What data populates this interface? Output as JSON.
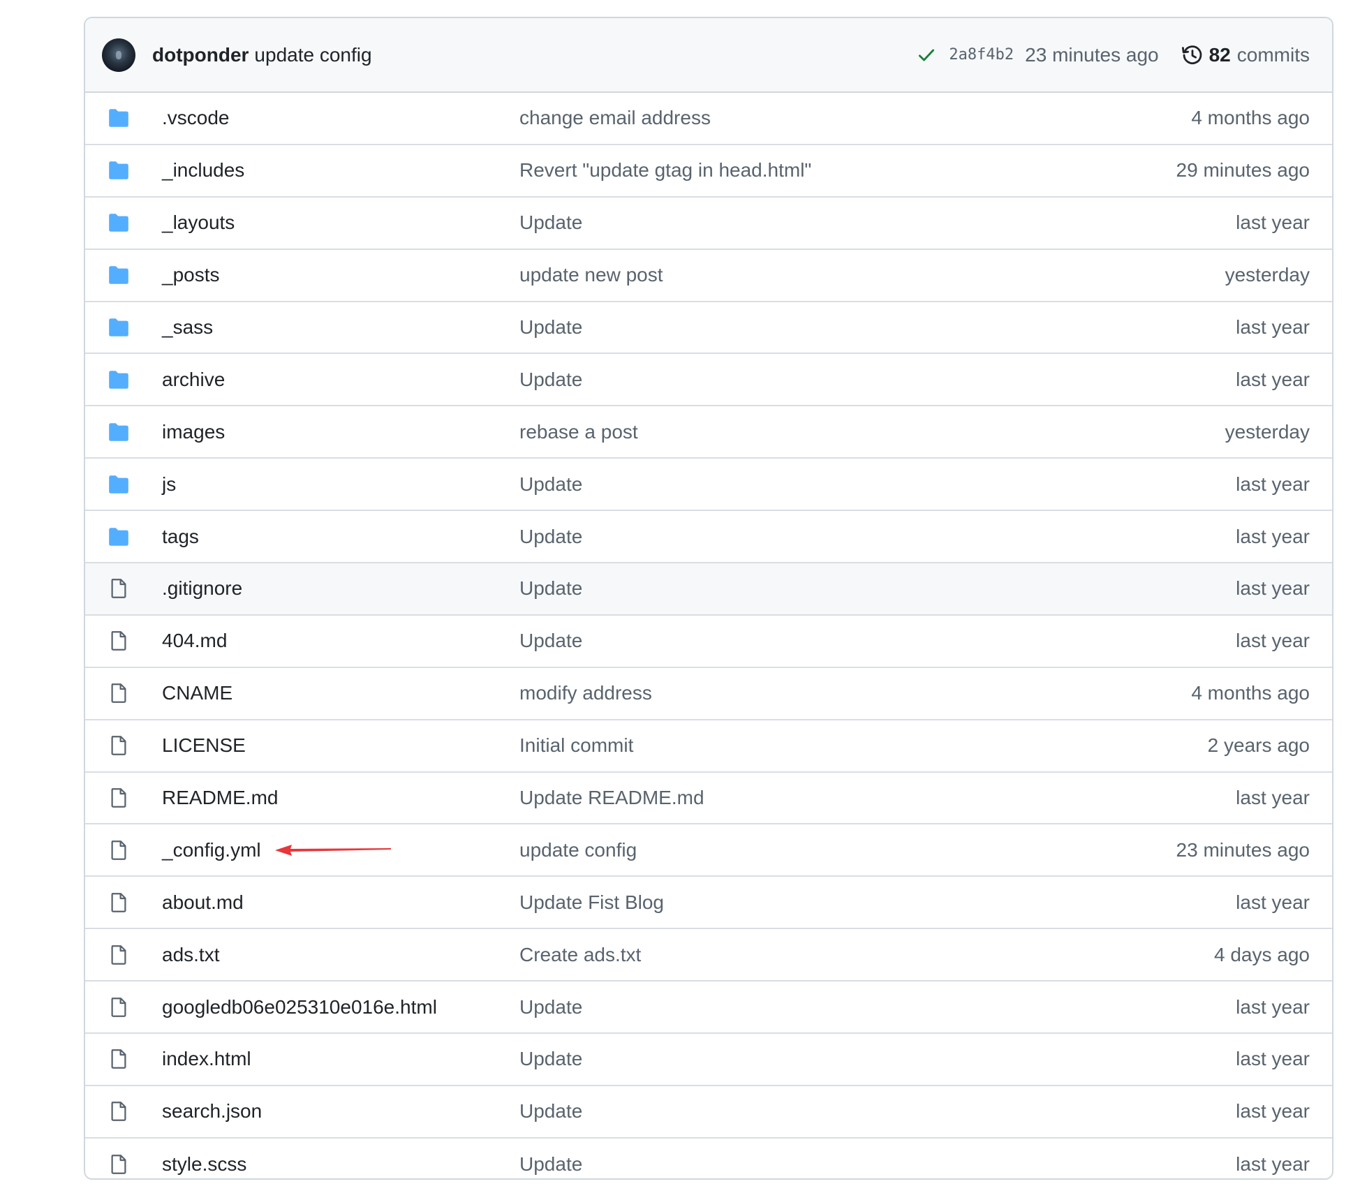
{
  "latest_commit": {
    "author": "dotponder",
    "message": "update config",
    "status_icon": "check-icon",
    "status_color": "#1a7f37",
    "sha": "2a8f4b2",
    "time": "23 minutes ago",
    "commit_count": "82",
    "commit_count_label": "commits",
    "history_icon": "history-icon"
  },
  "colors": {
    "folder": "#54aeff",
    "file": "#59636e",
    "annotation_arrow": "#e8363a"
  },
  "files": [
    {
      "type": "folder",
      "name": ".vscode",
      "message": "change email address",
      "age": "4 months ago"
    },
    {
      "type": "folder",
      "name": "_includes",
      "message": "Revert \"update gtag in head.html\"",
      "age": "29 minutes ago"
    },
    {
      "type": "folder",
      "name": "_layouts",
      "message": "Update",
      "age": "last year"
    },
    {
      "type": "folder",
      "name": "_posts",
      "message": "update new post",
      "age": "yesterday"
    },
    {
      "type": "folder",
      "name": "_sass",
      "message": "Update",
      "age": "last year"
    },
    {
      "type": "folder",
      "name": "archive",
      "message": "Update",
      "age": "last year"
    },
    {
      "type": "folder",
      "name": "images",
      "message": "rebase a post",
      "age": "yesterday"
    },
    {
      "type": "folder",
      "name": "js",
      "message": "Update",
      "age": "last year"
    },
    {
      "type": "folder",
      "name": "tags",
      "message": "Update",
      "age": "last year"
    },
    {
      "type": "file",
      "name": ".gitignore",
      "message": "Update",
      "age": "last year",
      "hovered": true
    },
    {
      "type": "file",
      "name": "404.md",
      "message": "Update",
      "age": "last year"
    },
    {
      "type": "file",
      "name": "CNAME",
      "message": "modify address",
      "age": "4 months ago"
    },
    {
      "type": "file",
      "name": "LICENSE",
      "message": "Initial commit",
      "age": "2 years ago"
    },
    {
      "type": "file",
      "name": "README.md",
      "message": "Update README.md",
      "age": "last year"
    },
    {
      "type": "file",
      "name": "_config.yml",
      "message": "update config",
      "age": "23 minutes ago",
      "annotated": true
    },
    {
      "type": "file",
      "name": "about.md",
      "message": "Update Fist Blog",
      "age": "last year"
    },
    {
      "type": "file",
      "name": "ads.txt",
      "message": "Create ads.txt",
      "age": "4 days ago"
    },
    {
      "type": "file",
      "name": "googledb06e025310e016e.html",
      "message": "Update",
      "age": "last year"
    },
    {
      "type": "file",
      "name": "index.html",
      "message": "Update",
      "age": "last year"
    },
    {
      "type": "file",
      "name": "search.json",
      "message": "Update",
      "age": "last year"
    },
    {
      "type": "file",
      "name": "style.scss",
      "message": "Update",
      "age": "last year"
    }
  ]
}
